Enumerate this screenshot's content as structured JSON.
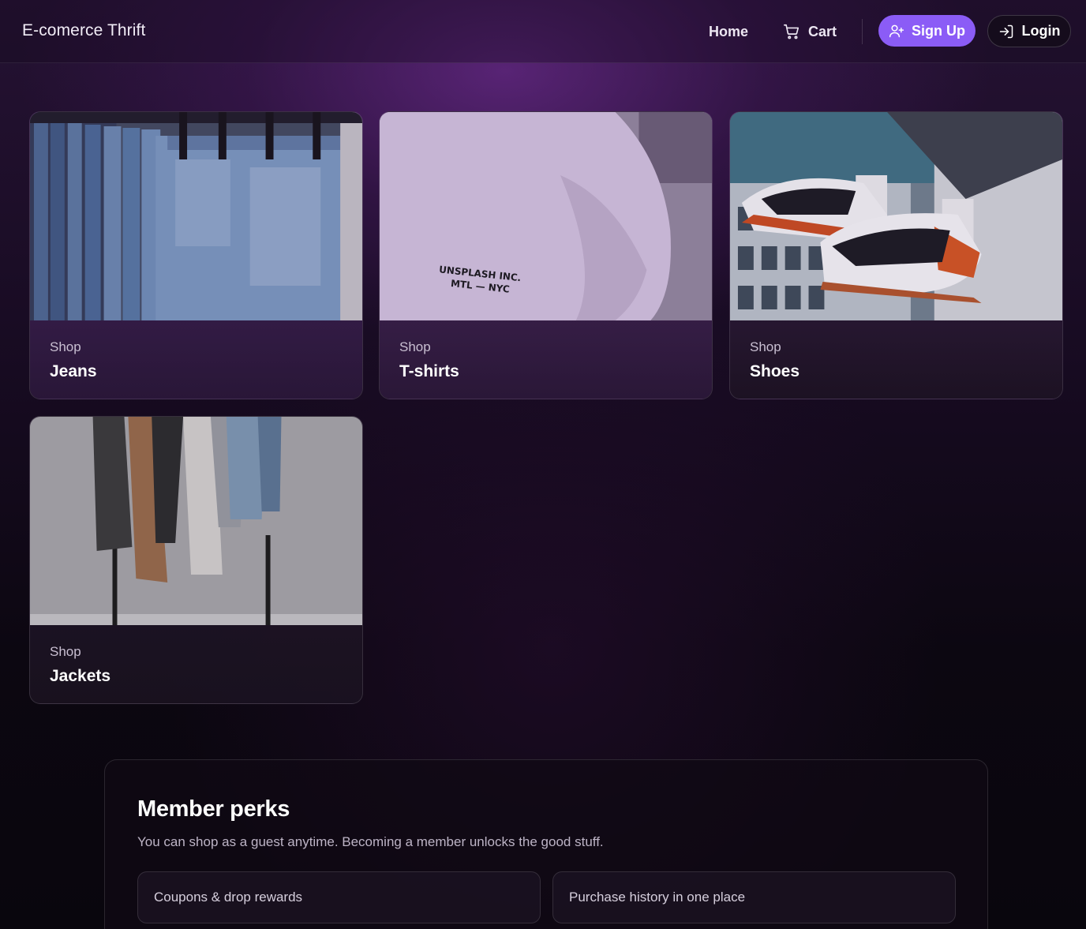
{
  "header": {
    "brand": "E-comerce Thrift",
    "nav": {
      "home": "Home",
      "cart": "Cart"
    },
    "signup_label": "Sign Up",
    "login_label": "Login"
  },
  "categories": [
    {
      "kicker": "Shop",
      "title": "Jeans",
      "image": "jeans-photo"
    },
    {
      "kicker": "Shop",
      "title": "T-shirts",
      "image": "tshirt-photo",
      "image_text": [
        "UNSPLASH INC.",
        "MTL — NYC"
      ]
    },
    {
      "kicker": "Shop",
      "title": "Shoes",
      "image": "shoes-photo"
    },
    {
      "kicker": "Shop",
      "title": "Jackets",
      "image": "jackets-photo"
    }
  ],
  "perks": {
    "title": "Member perks",
    "subtitle": "You can shop as a guest anytime. Becoming a member unlocks the good stuff.",
    "items": [
      "Coupons & drop rewards",
      "Purchase history in one place"
    ]
  },
  "colors": {
    "accent": "#8b5cf6",
    "background": "#0b0710",
    "glow": "#6a2a8c"
  },
  "icons": {
    "cart": "cart-icon",
    "signup": "user-plus-icon",
    "login": "login-icon"
  }
}
